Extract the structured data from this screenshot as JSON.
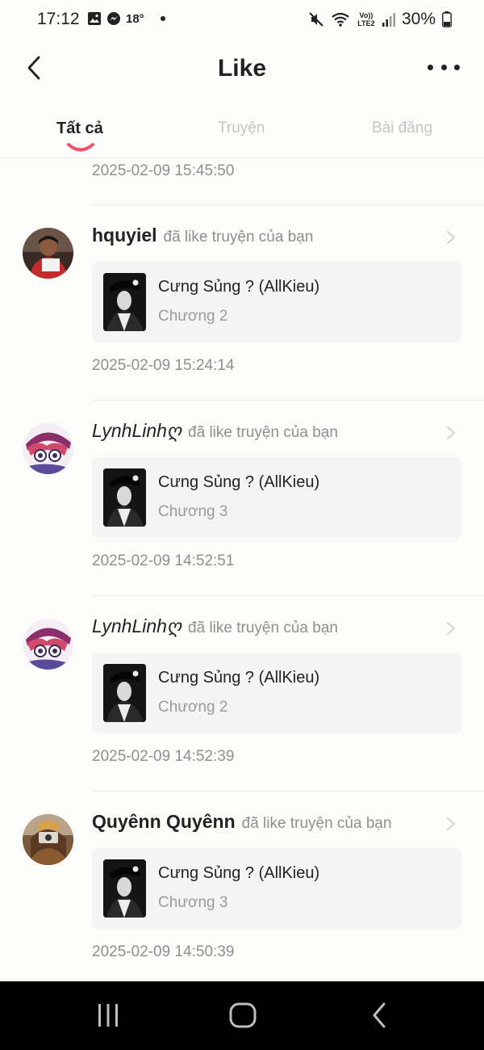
{
  "status_bar": {
    "time": "17:12",
    "temperature": "18°",
    "network": "Vo)) LTE2",
    "battery": "30%"
  },
  "header": {
    "title": "Like"
  },
  "tabs": [
    {
      "label": "Tất cả",
      "active": true
    },
    {
      "label": "Truyện",
      "active": false
    },
    {
      "label": "Bài đăng",
      "active": false
    }
  ],
  "top_timestamp": "2025-02-09 15:45:50",
  "entries": [
    {
      "username": "hquyiel",
      "action": "đã like truyện của bạn",
      "story_title": "Cưng Sủng ? (AllKieu)",
      "chapter": "Chương 2",
      "timestamp": "2025-02-09 15:24:14"
    },
    {
      "username": "LynhLinhღ",
      "action": "đã like truyện của bạn",
      "story_title": "Cưng Sủng ? (AllKieu)",
      "chapter": "Chương 3",
      "timestamp": "2025-02-09 14:52:51"
    },
    {
      "username": "LynhLinhღ",
      "action": "đã like truyện của bạn",
      "story_title": "Cưng Sủng ? (AllKieu)",
      "chapter": "Chương 2",
      "timestamp": "2025-02-09 14:52:39"
    },
    {
      "username": "Quyênn Quyênn",
      "action": "đã like truyện của bạn",
      "story_title": "Cưng Sủng ? (AllKieu)",
      "chapter": "Chương 3",
      "timestamp": "2025-02-09 14:50:39"
    }
  ],
  "colors": {
    "accent": "#f0506e",
    "background": "#fcfcfa",
    "card": "#f4f4f4",
    "muted_text": "#8f8f8f"
  }
}
